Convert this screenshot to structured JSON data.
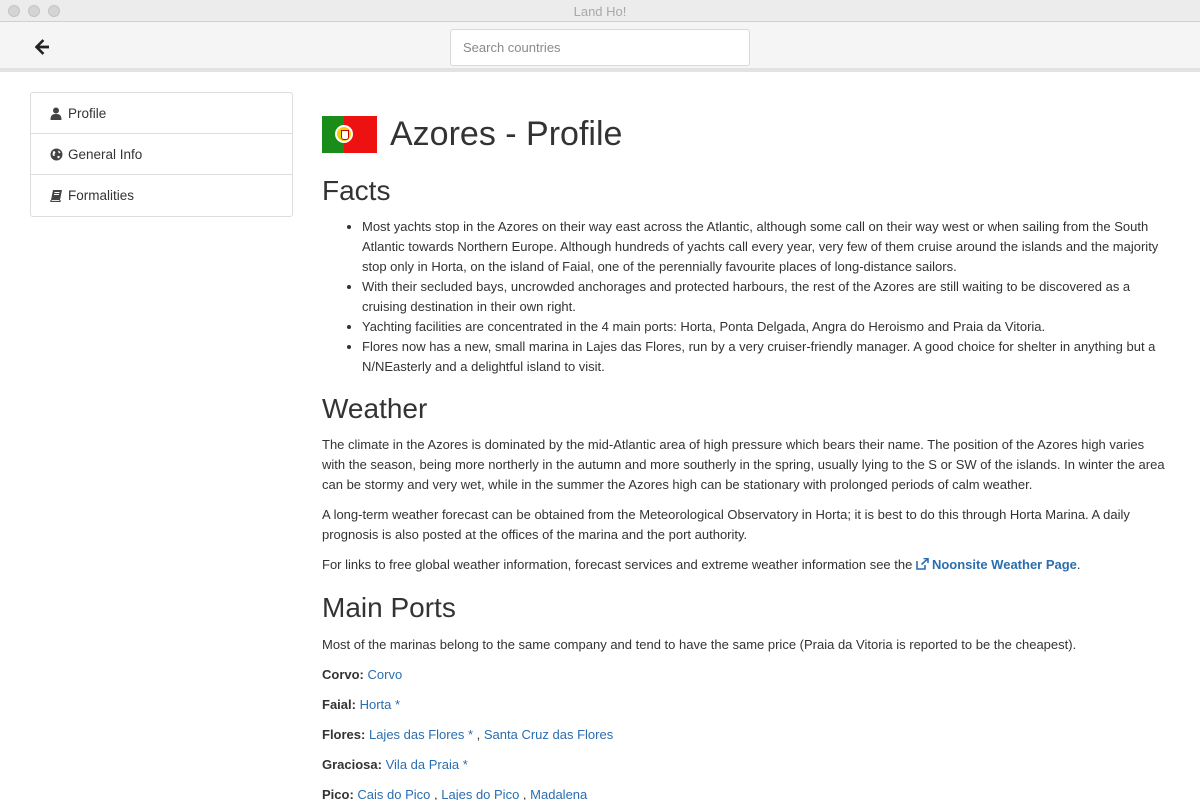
{
  "window": {
    "title": "Land Ho!"
  },
  "toolbar": {
    "search_placeholder": "Search countries"
  },
  "sidebar": {
    "items": [
      {
        "label": "Profile",
        "icon": "user-icon"
      },
      {
        "label": "General Info",
        "icon": "globe-icon"
      },
      {
        "label": "Formalities",
        "icon": "book-icon"
      }
    ]
  },
  "page": {
    "title": "Azores - Profile",
    "flag": "portugal-flag",
    "facts_heading": "Facts",
    "facts": [
      "Most yachts stop in the Azores on their way east across the Atlantic, although some call on their way west or when sailing from the South Atlantic towards Northern Europe. Although hundreds of yachts call every year, very few of them cruise around the islands and the majority stop only in Horta, on the island of Faial, one of the perennially favourite places of long-distance sailors.",
      "With their secluded bays, uncrowded anchorages and protected harbours, the rest of the Azores are still waiting to be discovered as a cruising destination in their own right.",
      "Yachting facilities are concentrated in the 4 main ports: Horta, Ponta Delgada, Angra do Heroismo and Praia da Vitoria.",
      "Flores now has a new, small marina in Lajes das Flores, run by a very cruiser-friendly manager. A good choice for shelter in anything but a N/NEasterly and a delightful island to visit."
    ],
    "weather_heading": "Weather",
    "weather_p1": "The climate in the Azores is dominated by the mid-Atlantic area of high pressure which bears their name. The position of the Azores high varies with the season, being more northerly in the autumn and more southerly in the spring, usually lying to the S or SW of the islands. In winter the area can be stormy and very wet, while in the summer the Azores high can be stationary with prolonged periods of calm weather.",
    "weather_p2": "A long-term weather forecast can be obtained from the Meteorological Observatory in Horta; it is best to do this through Horta Marina. A daily prognosis is also posted at the offices of the marina and the port authority.",
    "weather_p3_prefix": "For links to free global weather information, forecast services and extreme weather information see the ",
    "weather_p3_link": "Noonsite Weather Page",
    "weather_p3_suffix": ".",
    "ports_heading": "Main Ports",
    "ports_intro": "Most of the marinas belong to the same company and tend to have the same price (Praia da Vitoria is reported to be the cheapest).",
    "ports": [
      {
        "island": "Corvo:",
        "links": [
          "Corvo"
        ]
      },
      {
        "island": "Faial:",
        "links": [
          "Horta *"
        ]
      },
      {
        "island": "Flores:",
        "links": [
          "Lajes das Flores *",
          "Santa Cruz das Flores"
        ]
      },
      {
        "island": "Graciosa:",
        "links": [
          "Vila da Praia *"
        ]
      },
      {
        "island": "Pico:",
        "links": [
          "Cais do Pico",
          "Lajes do Pico",
          "Madalena"
        ]
      }
    ]
  }
}
